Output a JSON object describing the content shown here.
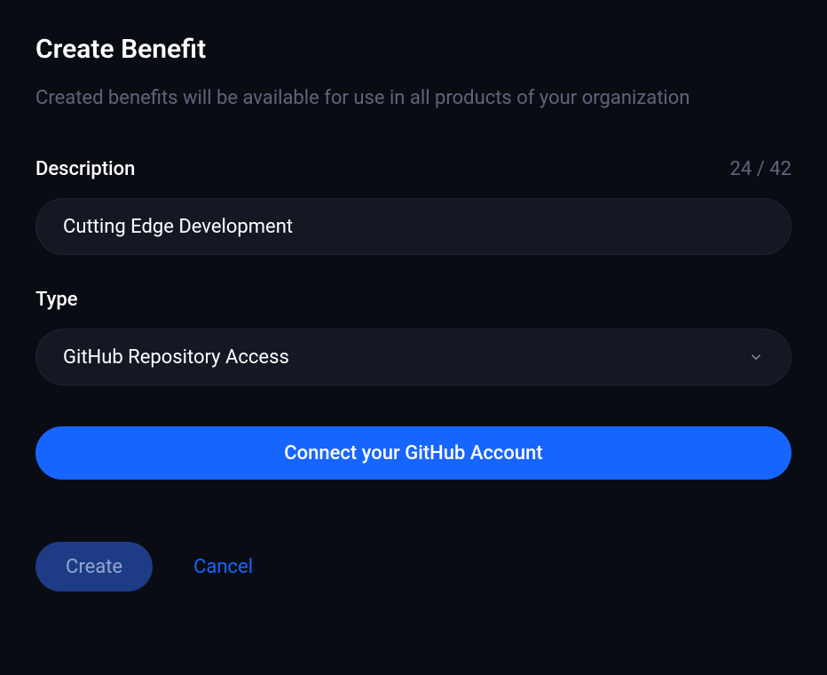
{
  "header": {
    "title": "Create Benefit",
    "subtitle": "Created benefits will be available for use in all products of your organization"
  },
  "fields": {
    "description": {
      "label": "Description",
      "value": "Cutting Edge Development",
      "char_count": "24 / 42"
    },
    "type": {
      "label": "Type",
      "value": "GitHub Repository Access"
    }
  },
  "buttons": {
    "connect": "Connect your GitHub Account",
    "create": "Create",
    "cancel": "Cancel"
  }
}
